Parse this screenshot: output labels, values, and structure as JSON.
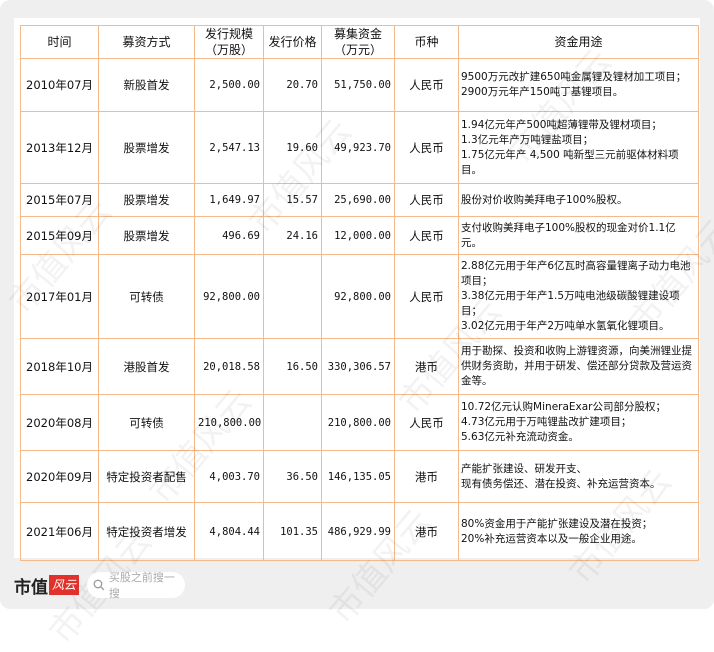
{
  "watermark": "市值风云",
  "headers": [
    "时间",
    "募资方式",
    "发行规模\n（万股）",
    "发行价格",
    "募集资金\n（万元）",
    "币种",
    "资金用途"
  ],
  "rows": [
    {
      "date": "2010年07月",
      "method": "新股首发",
      "shares": "2,500.00",
      "price": "20.70",
      "amount": "51,750.00",
      "currency": "人民币",
      "use": "9500万元改扩建650吨金属锂及锂材加工项目；\n2900万元年产150吨丁基锂项目。"
    },
    {
      "date": "2013年12月",
      "method": "股票增发",
      "shares": "2,547.13",
      "price": "19.60",
      "amount": "49,923.70",
      "currency": "人民币",
      "use": "1.94亿元年产500吨超薄锂带及锂材项目；\n1.3亿元年产万吨锂盐项目；\n1.75亿元年产 4,500 吨新型三元前驱体材料项目。"
    },
    {
      "date": "2015年07月",
      "method": "股票增发",
      "shares": "1,649.97",
      "price": "15.57",
      "amount": "25,690.00",
      "currency": "人民币",
      "use": "股份对价收购美拜电子100%股权。"
    },
    {
      "date": "2015年09月",
      "method": "股票增发",
      "shares": "496.69",
      "price": "24.16",
      "amount": "12,000.00",
      "currency": "人民币",
      "use": "支付收购美拜电子100%股权的现金对价1.1亿元。"
    },
    {
      "date": "2017年01月",
      "method": "可转债",
      "shares": "92,800.00",
      "price": "",
      "amount": "92,800.00",
      "currency": "人民币",
      "use": "2.88亿元用于年产6亿瓦时高容量锂离子动力电池项目；\n3.38亿元用于年产1.5万吨电池级碳酸锂建设项目；\n3.02亿元用于年产2万吨单水氢氧化锂项目。"
    },
    {
      "date": "2018年10月",
      "method": "港股首发",
      "shares": "20,018.58",
      "price": "16.50",
      "amount": "330,306.57",
      "currency": "港币",
      "use": "用于勘探、投资和收购上游锂资源，向美洲锂业提供财务资助，并用于研发、偿还部分贷款及营运资金等。"
    },
    {
      "date": "2020年08月",
      "method": "可转债",
      "shares": "210,800.00",
      "price": "",
      "amount": "210,800.00",
      "currency": "人民币",
      "use": "10.72亿元认购MineraExar公司部分股权；\n4.73亿元用于万吨锂盐改扩建项目；\n5.63亿元补充流动资金。"
    },
    {
      "date": "2020年09月",
      "method": "特定投资者配售",
      "shares": "4,003.70",
      "price": "36.50",
      "amount": "146,135.05",
      "currency": "港币",
      "use": "产能扩张建设、研发开支、\n现有债务偿还、潜在投资、补充运营资本。"
    },
    {
      "date": "2021年06月",
      "method": "特定投资者增发",
      "shares": "4,804.44",
      "price": "101.35",
      "amount": "486,929.99",
      "currency": "港币",
      "use": "80%资金用于产能扩张建设及潜在投资；\n20%补充运营资本以及一般企业用途。"
    }
  ],
  "footer": {
    "logo_text": "市值",
    "logo_badge": "风云",
    "search_placeholder": "买股之前搜一搜"
  }
}
